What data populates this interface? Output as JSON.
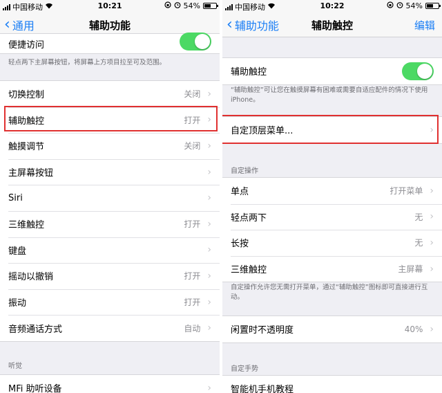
{
  "left": {
    "status": {
      "carrier": "中国移动",
      "time": "10:21",
      "battery": "54%"
    },
    "nav": {
      "back": "通用",
      "title": "辅助功能"
    },
    "top_row": {
      "label": "便捷访问"
    },
    "top_note": "轻点两下主屏幕按钮，将屏幕上方项目拉至可及范围。",
    "items": [
      {
        "label": "切换控制",
        "value": "关闭"
      },
      {
        "label": "辅助触控",
        "value": "打开"
      },
      {
        "label": "触摸调节",
        "value": "关闭"
      },
      {
        "label": "主屏幕按钮",
        "value": ""
      },
      {
        "label": "Siri",
        "value": ""
      },
      {
        "label": "三维触控",
        "value": "打开"
      },
      {
        "label": "键盘",
        "value": ""
      },
      {
        "label": "摇动以撤销",
        "value": "打开"
      },
      {
        "label": "振动",
        "value": "打开"
      },
      {
        "label": "音频通话方式",
        "value": "自动"
      }
    ],
    "hearing_header": "听觉",
    "hearing_items": [
      {
        "label": "MFi 助听设备",
        "value": ""
      }
    ]
  },
  "right": {
    "status": {
      "carrier": "中国移动",
      "time": "10:22",
      "battery": "54%"
    },
    "nav": {
      "back": "辅助功能",
      "title": "辅助触控",
      "edit": "编辑"
    },
    "toggle_row": {
      "label": "辅助触控"
    },
    "toggle_note": "“辅助触控”可让您在触摸屏幕有困难或需要自适应配件的情况下使用 iPhone。",
    "menu_row": {
      "label": "自定顶层菜单..."
    },
    "actions_header": "自定操作",
    "actions": [
      {
        "label": "单点",
        "value": "打开菜单"
      },
      {
        "label": "轻点两下",
        "value": "无"
      },
      {
        "label": "长按",
        "value": "无"
      },
      {
        "label": "三维触控",
        "value": "主屏幕"
      }
    ],
    "actions_note": "自定操作允许您无需打开菜单，通过“辅助触控”图标即可直接进行互动。",
    "opacity_row": {
      "label": "闲置时不透明度",
      "value": "40%"
    },
    "gestures_header": "自定手势",
    "gesture_row": {
      "label": "智能机手机教程"
    }
  },
  "icons": {
    "chevron": "›",
    "back_chevron": "‹",
    "wifi": "wifi-icon",
    "alarm": "alarm-icon",
    "lock": "orientation-lock-icon"
  },
  "colors": {
    "accent": "#1a7ef5",
    "toggle_on": "#4cd964",
    "highlight": "#e03030"
  }
}
